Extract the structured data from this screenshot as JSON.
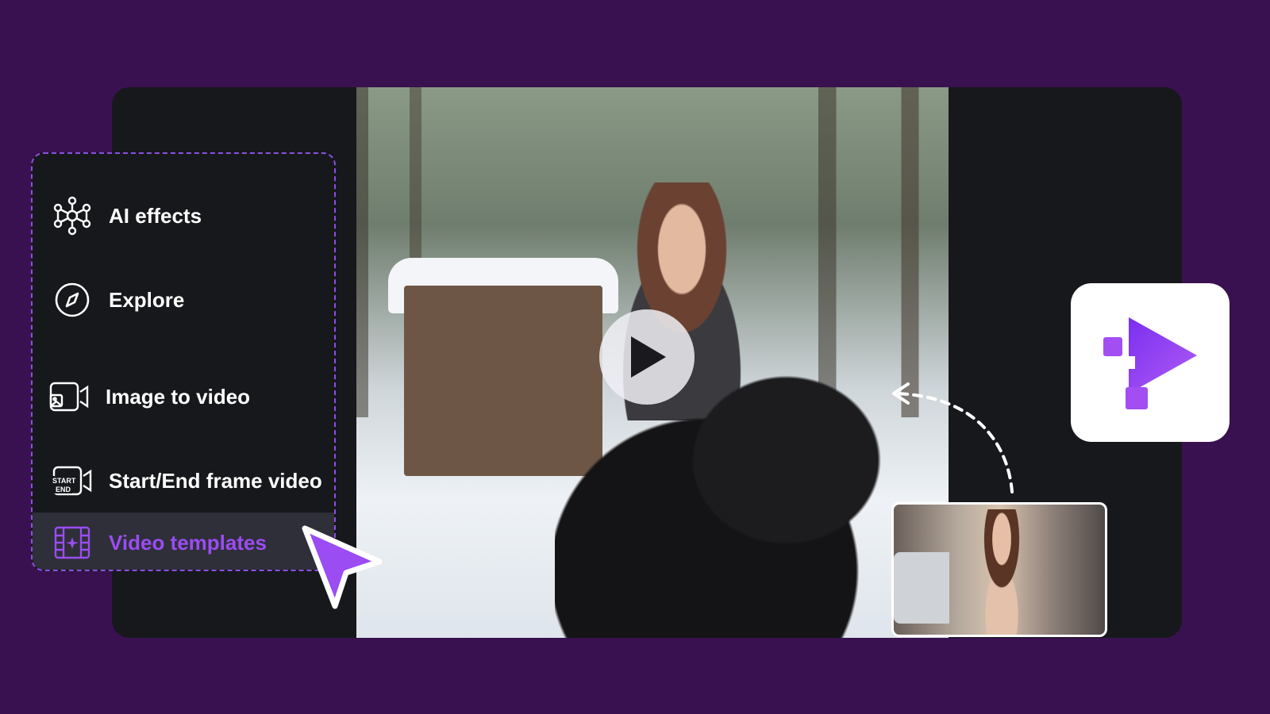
{
  "menu": {
    "items": [
      {
        "label": "AI effects",
        "icon": "ai-network-icon"
      },
      {
        "label": "Explore",
        "icon": "compass-icon"
      },
      {
        "label": "Image to video",
        "icon": "image-camera-icon"
      },
      {
        "label": "Start/End frame video",
        "icon": "start-end-camera-icon"
      },
      {
        "label": "Video templates",
        "icon": "film-sparkle-icon",
        "active": true
      }
    ]
  },
  "icons": {
    "start_label": "START",
    "end_label": "END"
  },
  "colors": {
    "background": "#3a1150",
    "panel": "#17181c",
    "accent": "#9b4cf2",
    "menu_border": "#8b4fe0"
  },
  "preview": {
    "play_icon": "play-icon"
  }
}
